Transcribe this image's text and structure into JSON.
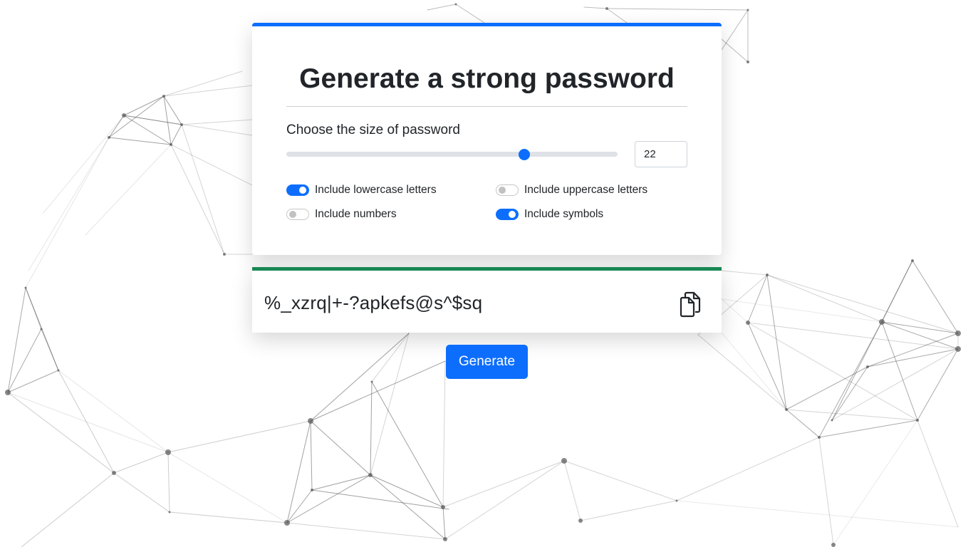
{
  "app": {
    "title": "Generate a strong password",
    "accent_color": "#0d6efd",
    "success_color": "#198754"
  },
  "size": {
    "label": "Choose the size of password",
    "value": "22",
    "slider_fraction": 0.718
  },
  "options": {
    "lowercase": {
      "label": "Include lowercase letters",
      "checked": true
    },
    "uppercase": {
      "label": "Include uppercase letters",
      "checked": false
    },
    "numbers": {
      "label": "Include numbers",
      "checked": false
    },
    "symbols": {
      "label": "Include symbols",
      "checked": true
    }
  },
  "result": {
    "password": "%_xzrq|+-?apkefs@s^$sq",
    "copy_icon": "copy-icon"
  },
  "actions": {
    "generate_label": "Generate"
  }
}
